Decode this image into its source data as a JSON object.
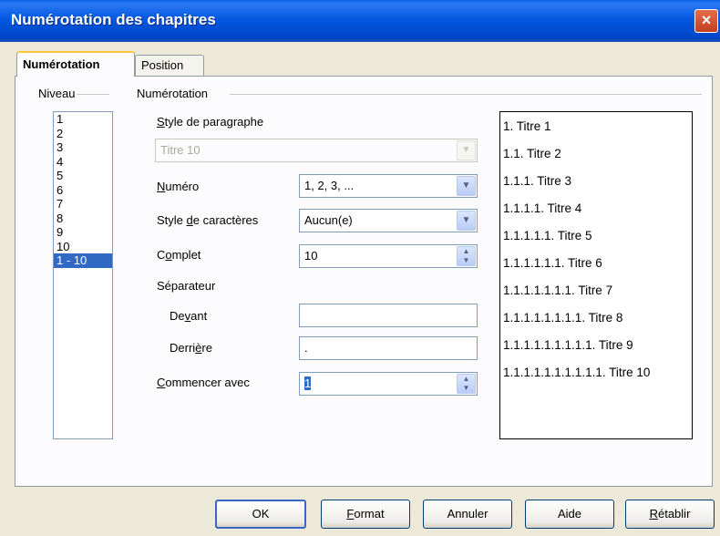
{
  "window": {
    "title": "Numérotation des chapitres",
    "close": "×"
  },
  "tabs": [
    {
      "label": "Numérotation"
    },
    {
      "label": "Position"
    }
  ],
  "level_group": {
    "label": "Niveau",
    "items": [
      "1",
      "2",
      "3",
      "4",
      "5",
      "6",
      "7",
      "8",
      "9",
      "10",
      "1 - 10"
    ],
    "selected": "1 - 10"
  },
  "numbering_group": {
    "label": "Numérotation",
    "paragraph_style": {
      "label_u": "S",
      "label_rest": "tyle de paragraphe",
      "value": "Titre 10"
    },
    "number": {
      "label_u": "N",
      "label_rest": "uméro",
      "value": "1, 2, 3, ..."
    },
    "char_style": {
      "label_pre": "Style ",
      "label_u": "d",
      "label_rest": "e caractères",
      "value": "Aucun(e)"
    },
    "complete": {
      "label_pre": "C",
      "label_u": "o",
      "label_rest": "mplet",
      "value": "10"
    },
    "separator": {
      "label": "Séparateur"
    },
    "before": {
      "label_pre": "De",
      "label_u": "v",
      "label_rest": "ant",
      "value": ""
    },
    "after": {
      "label_pre": "Derri",
      "label_u": "è",
      "label_rest": "re",
      "value": "."
    },
    "start_with": {
      "label_u": "C",
      "label_rest": "ommencer avec",
      "value": "1"
    }
  },
  "preview": [
    "1.  Titre 1",
    "1.1.  Titre 2",
    "1.1.1.  Titre 3",
    "1.1.1.1.  Titre 4",
    "1.1.1.1.1.  Titre 5",
    "1.1.1.1.1.1.  Titre 6",
    "1.1.1.1.1.1.1.  Titre 7",
    "1.1.1.1.1.1.1.1.  Titre 8",
    "1.1.1.1.1.1.1.1.1.  Titre 9",
    "1.1.1.1.1.1.1.1.1.1.  Titre 10"
  ],
  "buttons": {
    "ok": "OK",
    "format_u": "F",
    "format_rest": "ormat",
    "cancel": "Annuler",
    "help": "Aide",
    "reset_u": "R",
    "reset_rest": "établir"
  },
  "icons": {
    "dropdown": "▼",
    "spin_up": "▲",
    "spin_down": "▼"
  }
}
